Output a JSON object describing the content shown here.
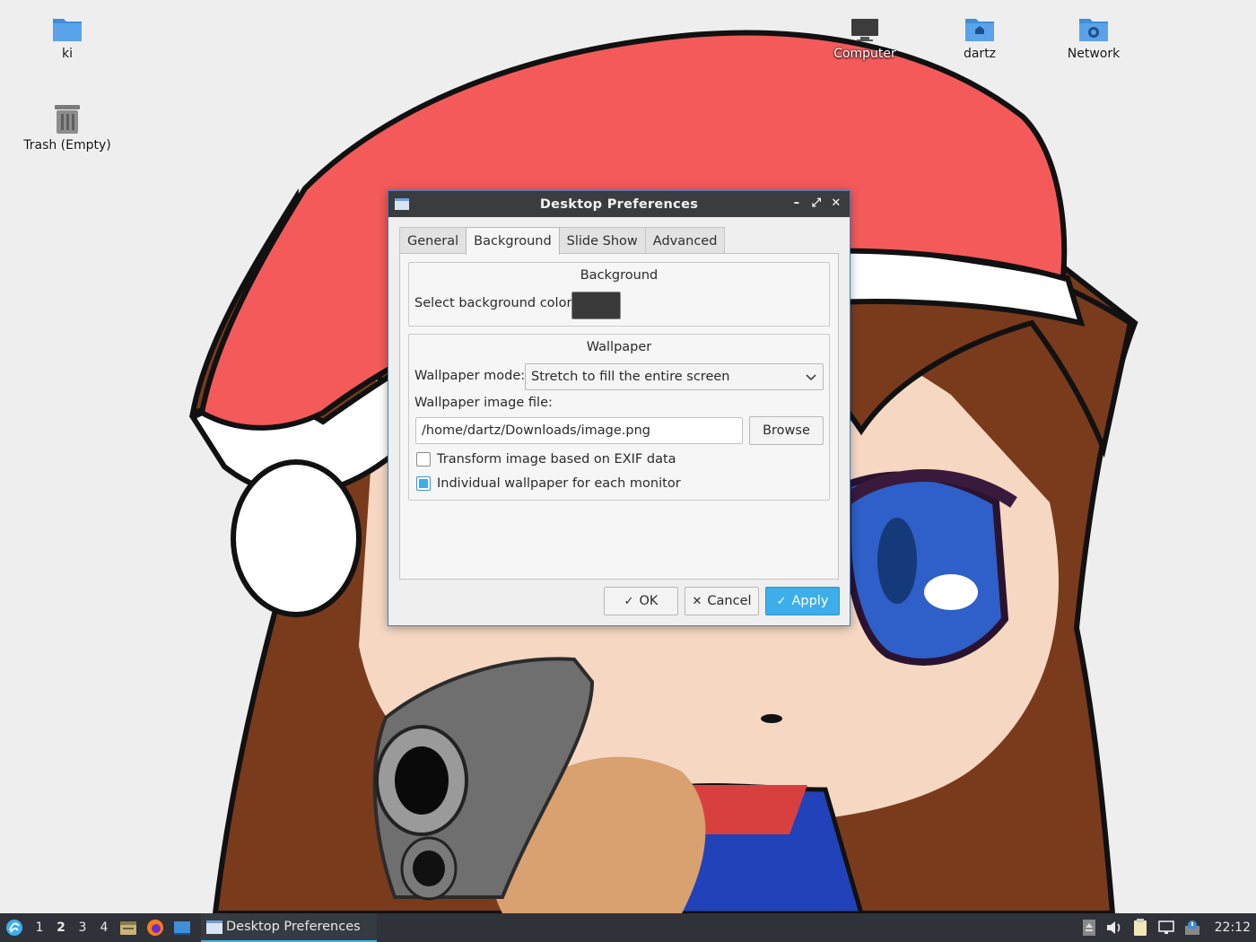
{
  "desktop": {
    "icons": [
      {
        "label": "ki",
        "icon": "folder-icon"
      },
      {
        "label": "Trash (Empty)",
        "icon": "trash-icon"
      },
      {
        "label": "Computer",
        "icon": "computer-icon"
      },
      {
        "label": "dartz",
        "icon": "home-folder-icon"
      },
      {
        "label": "Network",
        "icon": "network-folder-icon"
      }
    ]
  },
  "dialog": {
    "title": "Desktop Preferences",
    "tabs": [
      {
        "label": "General",
        "active": false
      },
      {
        "label": "Background",
        "active": true
      },
      {
        "label": "Slide Show",
        "active": false
      },
      {
        "label": "Advanced",
        "active": false
      }
    ],
    "background_group": {
      "title": "Background",
      "color_label": "Select background color:",
      "color_value": "#3a3a3a"
    },
    "wallpaper_group": {
      "title": "Wallpaper",
      "mode_label": "Wallpaper mode:",
      "mode_value": "Stretch to fill the entire screen",
      "file_label": "Wallpaper image file:",
      "file_value": "/home/dartz/Downloads/image.png",
      "browse_label": "Browse",
      "exif_label": "Transform image based on EXIF data",
      "exif_checked": false,
      "individual_label": "Individual wallpaper for each monitor",
      "individual_checked": true
    },
    "buttons": {
      "ok": "OK",
      "cancel": "Cancel",
      "apply": "Apply"
    }
  },
  "taskbar": {
    "desktops": [
      "1",
      "2",
      "3",
      "4"
    ],
    "active_desktop": "2",
    "task_label": "Desktop Preferences",
    "clock": "22:12"
  },
  "colors": {
    "accent": "#3daee9",
    "titlebar": "#3a3c40",
    "taskbar": "#2f3238"
  }
}
